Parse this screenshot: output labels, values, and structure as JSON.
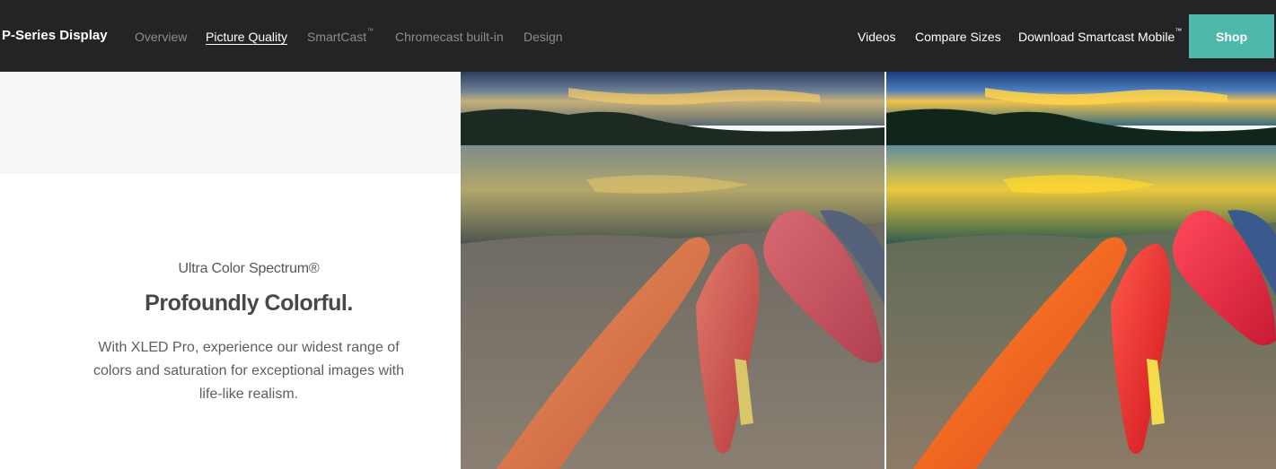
{
  "nav": {
    "brand": "P-Series Display",
    "links": [
      {
        "label": "Overview"
      },
      {
        "label": "Picture Quality"
      },
      {
        "label": "SmartCast",
        "sup": "™"
      },
      {
        "label": "Chromecast built-in"
      },
      {
        "label": "Design"
      }
    ],
    "right_links": [
      {
        "label": "Videos"
      },
      {
        "label": "Compare Sizes"
      },
      {
        "label": "Download Smartcast Mobile",
        "sup": "™"
      }
    ],
    "shop_label": "Shop"
  },
  "feature": {
    "eyebrow": "Ultra Color Spectrum®",
    "headline": "Profoundly Colorful.",
    "body": "With XLED Pro, experience our widest range of colors and saturation for exceptional images with life-like realism."
  },
  "colors": {
    "nav_bg": "#232425",
    "accent": "#4fb8aa"
  }
}
